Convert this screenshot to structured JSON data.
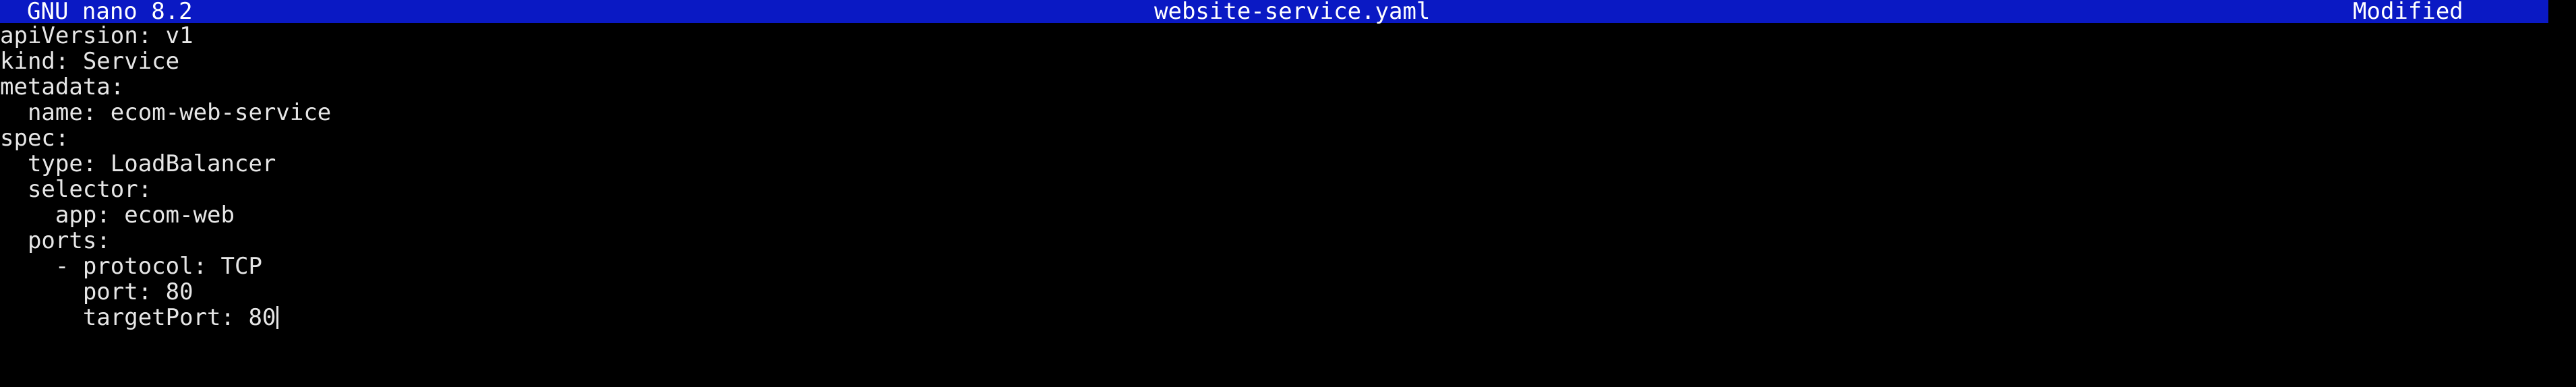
{
  "titlebar": {
    "app_name": "GNU nano 8.2",
    "file_name": "website-service.yaml",
    "status": "Modified"
  },
  "editor": {
    "lines": [
      "apiVersion: v1",
      "kind: Service",
      "metadata:",
      "  name: ecom-web-service",
      "spec:",
      "  type: LoadBalancer",
      "  selector:",
      "    app: ecom-web",
      "  ports:",
      "    - protocol: TCP",
      "      port: 80",
      "      targetPort: 80"
    ]
  },
  "colors": {
    "titlebar_bg": "#0a19c4",
    "titlebar_fg": "#ffffff",
    "editor_bg": "#000000",
    "editor_fg": "#e6e6e6"
  }
}
